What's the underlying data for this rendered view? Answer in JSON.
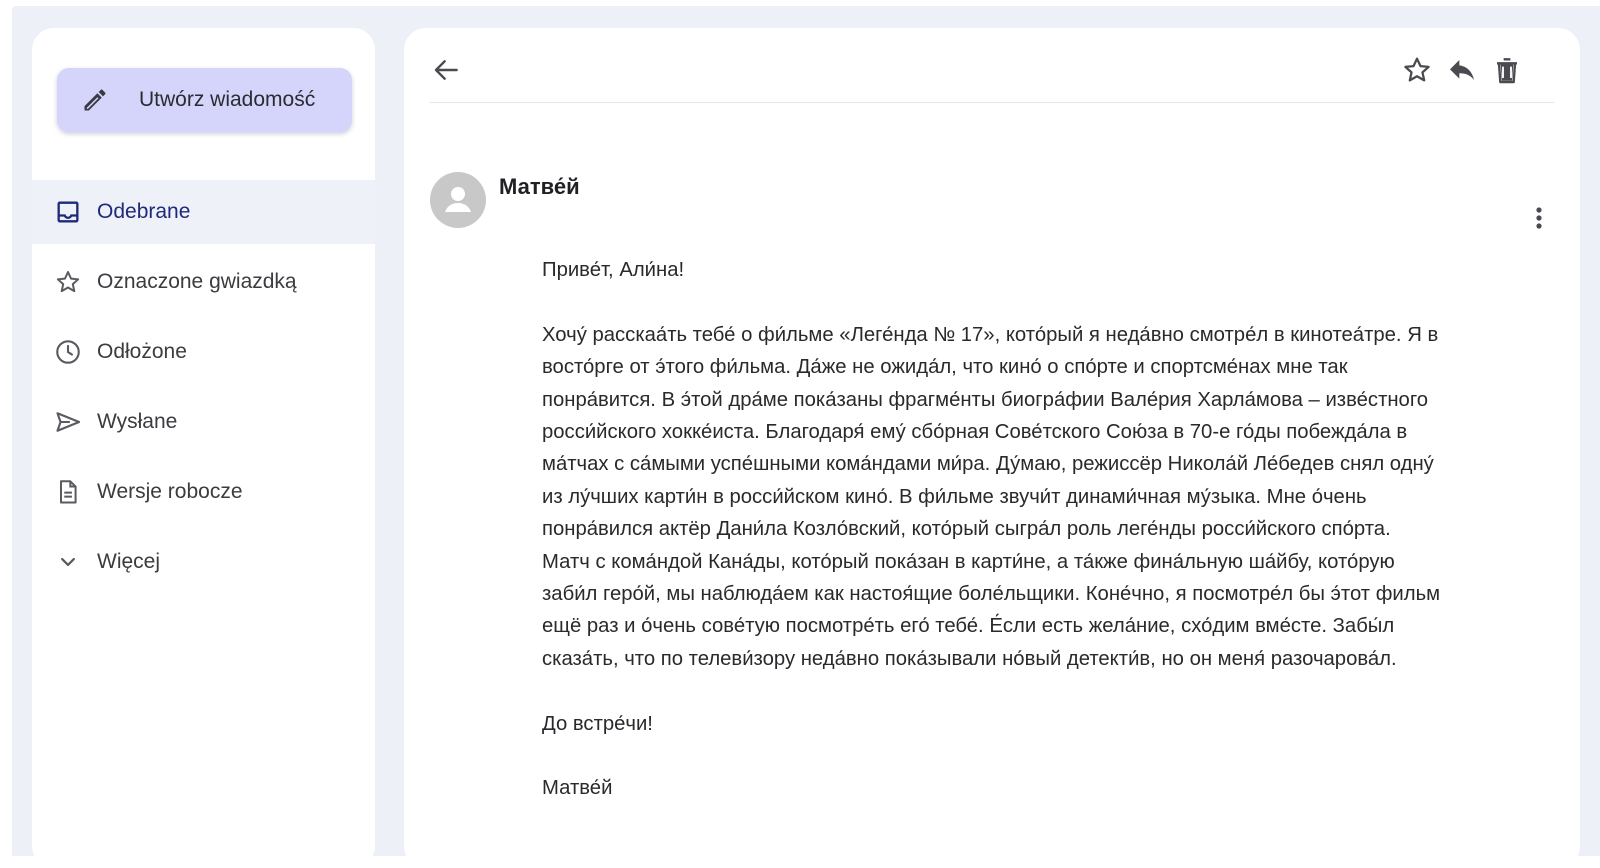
{
  "compose": {
    "label": "Utwórz wiadomość",
    "icon": "pencil-icon"
  },
  "sidebar": {
    "items": [
      {
        "label": "Odebrane",
        "icon": "inbox-icon",
        "active": true
      },
      {
        "label": "Oznaczone gwiazdką",
        "icon": "star-icon"
      },
      {
        "label": "Odłożone",
        "icon": "clock-icon"
      },
      {
        "label": "Wysłane",
        "icon": "send-icon"
      },
      {
        "label": "Wersje robocze",
        "icon": "document-icon"
      },
      {
        "label": "Więcej",
        "icon": "chevron-down-icon"
      }
    ]
  },
  "toolbar": {
    "icons": [
      "back-arrow-icon",
      "star-icon",
      "reply-icon",
      "trash-icon"
    ]
  },
  "message": {
    "sender": "Матве́й",
    "greeting": "Приве́т, Али́на!",
    "body": "Хочу́ расскаа́ть тебе́ о фи́льме «Леге́нда № 17», кото́рый я неда́вно смотре́л в кинотеа́тре. Я в восто́рге от э́того фи́льма. Да́же не ожида́л, что кино́ о спо́рте и спортсме́нах мне так понра́вится. В э́той дра́ме пока́заны фрагме́нты биогра́фии Вале́рия Харла́мова – изве́стного росси́йского хокке́иста. Благодаря́ ему́ сбо́рная Сове́тского Сою́за в 70-е го́ды побежда́ла в ма́тчах с са́мыми успе́шными кома́ндами ми́ра. Ду́маю, режиссёр Никола́й Ле́бедев снял одну́ из лу́чших карти́н в росси́йском кино́. В фи́льме звучи́т динами́чная му́зыка. Мне о́чень понра́вился актёр Дани́ла Козло́вский, кото́рый сыгра́л роль леге́нды росси́йского спо́рта. Матч с кома́ндой Кана́ды, кото́рый пока́зан в карти́не, а та́кже фина́льную ша́йбу, кото́рую заби́л геро́й, мы наблюда́ем как настоя́щие боле́льщики. Коне́чно, я посмотре́л бы э́тот фильм ещё раз и о́чень сове́тую посмотре́ть его́ тебе́. Е́сли есть жела́ние, схо́дим вме́сте. Забы́л сказа́ть, что по телеви́зору неда́вно пока́зывали но́вый детекти́в, но он меня́ разочарова́л.",
    "closing": "До встре́чи!",
    "signature": "Матве́й"
  }
}
